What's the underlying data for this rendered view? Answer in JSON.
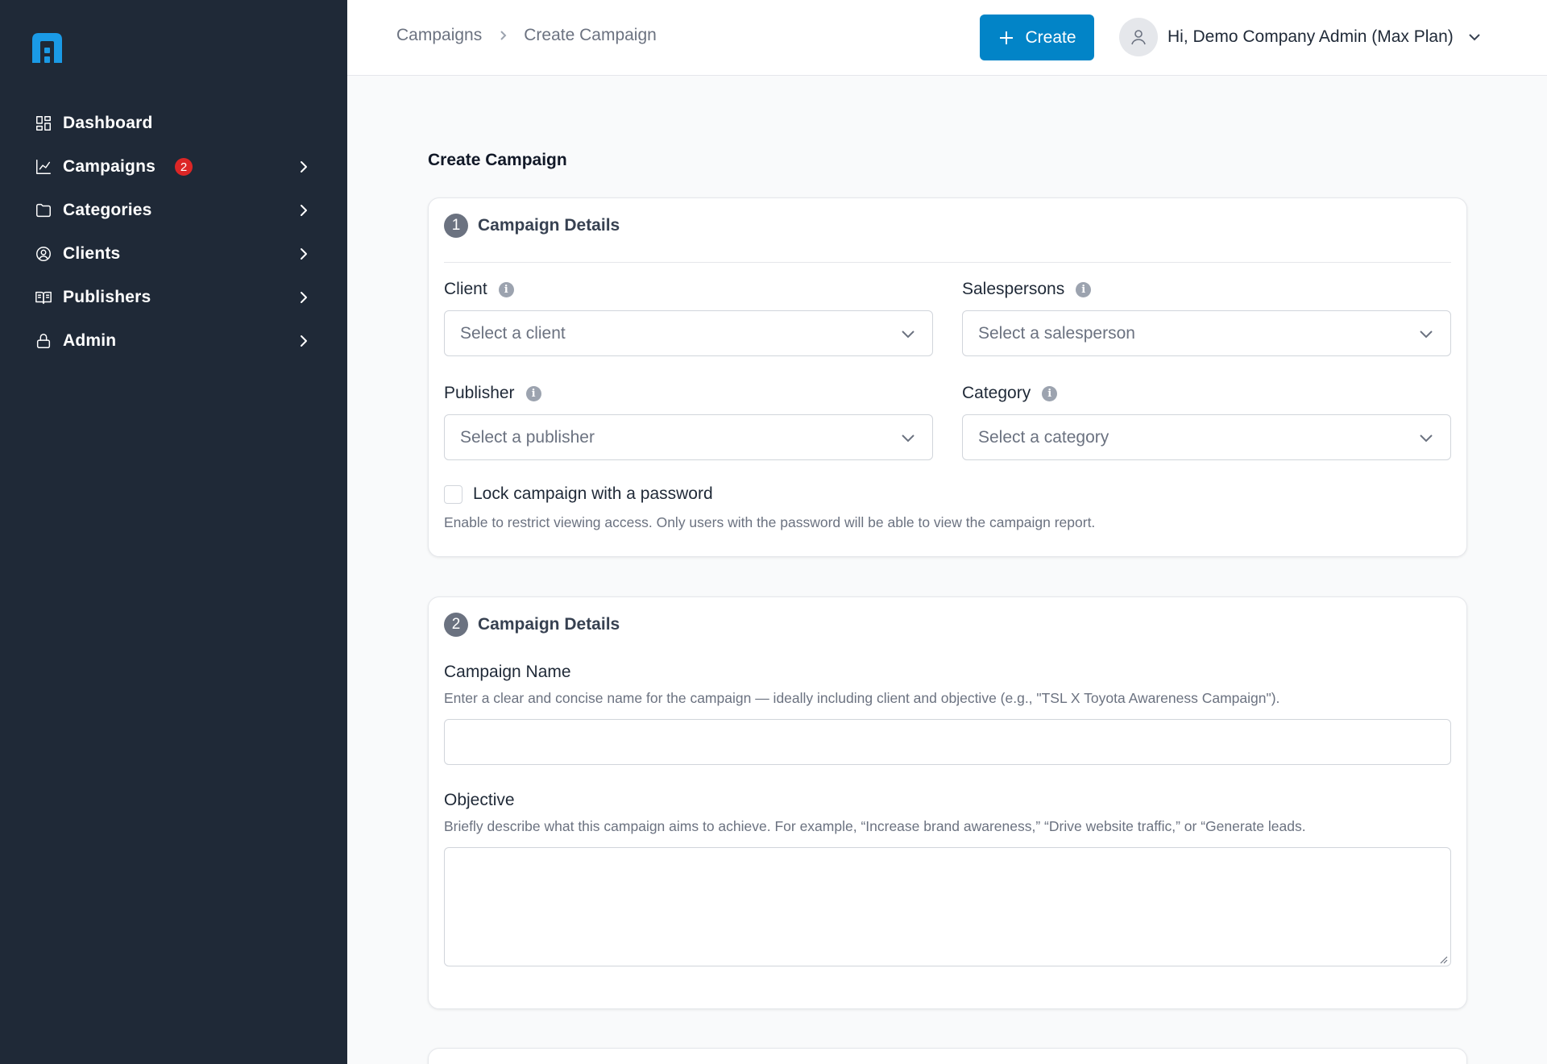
{
  "sidebar": {
    "logo_icon": "app-logo",
    "items": [
      {
        "label": "Dashboard",
        "icon": "dashboard-icon"
      },
      {
        "label": "Campaigns",
        "icon": "chart-line-icon",
        "badge": "2"
      },
      {
        "label": "Categories",
        "icon": "folder-icon"
      },
      {
        "label": "Clients",
        "icon": "user-circle-icon"
      },
      {
        "label": "Publishers",
        "icon": "book-open-icon"
      },
      {
        "label": "Admin",
        "icon": "lock-icon"
      }
    ]
  },
  "header": {
    "breadcrumb": [
      "Campaigns",
      "Create Campaign"
    ],
    "create_label": "Create",
    "user_greeting": "Hi, Demo Company Admin (Max Plan)"
  },
  "main": {
    "page_title": "Create Campaign",
    "section1": {
      "step": "1",
      "title": "Campaign Details",
      "client_label": "Client",
      "client_placeholder": "Select a client",
      "salesperson_label": "Salespersons",
      "salesperson_placeholder": "Select a salesperson",
      "publisher_label": "Publisher",
      "publisher_placeholder": "Select a publisher",
      "category_label": "Category",
      "category_placeholder": "Select a category",
      "lock_label": "Lock campaign with a password",
      "lock_help": "Enable to restrict viewing access. Only users with the password will be able to view the campaign report."
    },
    "section2": {
      "step": "2",
      "title": "Campaign Details",
      "name_label": "Campaign Name",
      "name_help": "Enter a clear and concise name for the campaign — ideally including client and objective (e.g., \"TSL X Toyota Awareness Campaign\").",
      "name_value": "",
      "objective_label": "Objective",
      "objective_help": "Briefly describe what this campaign aims to achieve. For example, “Increase brand awareness,” “Drive website traffic,” or “Generate leads.",
      "objective_value": ""
    },
    "colors": {
      "sidebar_bg": "#1f2937",
      "primary": "#0284c7",
      "badge": "#dc2626"
    }
  }
}
